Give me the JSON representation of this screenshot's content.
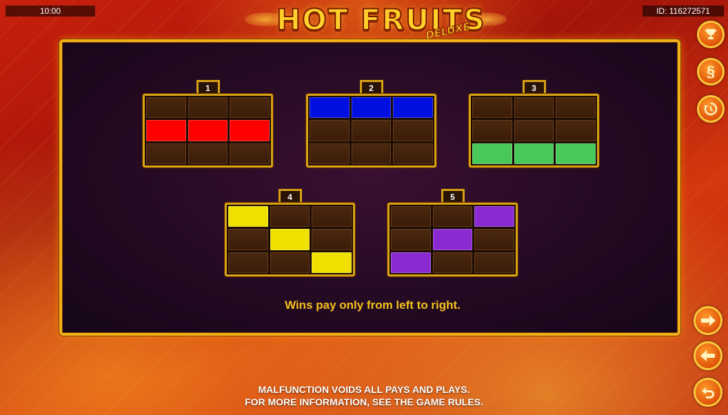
{
  "status": {
    "time": "10:00",
    "game_id": "ID: 116272571"
  },
  "logo": {
    "main": "HOT FRUITS",
    "sub": "DELUXE"
  },
  "paylines": [
    {
      "number": "1",
      "color": "#ff0000",
      "pattern": [
        [
          0,
          0,
          0
        ],
        [
          1,
          1,
          1
        ],
        [
          0,
          0,
          0
        ]
      ]
    },
    {
      "number": "2",
      "color": "#0010e0",
      "pattern": [
        [
          1,
          1,
          1
        ],
        [
          0,
          0,
          0
        ],
        [
          0,
          0,
          0
        ]
      ]
    },
    {
      "number": "3",
      "color": "#48c858",
      "pattern": [
        [
          0,
          0,
          0
        ],
        [
          0,
          0,
          0
        ],
        [
          1,
          1,
          1
        ]
      ]
    },
    {
      "number": "4",
      "color": "#f0e000",
      "pattern": [
        [
          1,
          0,
          0
        ],
        [
          0,
          1,
          0
        ],
        [
          0,
          0,
          1
        ]
      ]
    },
    {
      "number": "5",
      "color": "#8a2ad0",
      "pattern": [
        [
          0,
          0,
          1
        ],
        [
          0,
          1,
          0
        ],
        [
          1,
          0,
          0
        ]
      ]
    }
  ],
  "note": "Wins pay only from left to right.",
  "disclaimer": {
    "line1": "MALFUNCTION VOIDS ALL PAYS AND PLAYS.",
    "line2": "FOR MORE INFORMATION, SEE THE GAME RULES."
  },
  "side_buttons": {
    "paytable_icon": "trophy-icon",
    "rules_icon": "section-icon",
    "history_icon": "history-icon",
    "rules_symbol": "§"
  },
  "nav_buttons": {
    "next_icon": "arrow-right-icon",
    "prev_icon": "arrow-left-icon",
    "back_icon": "return-icon"
  },
  "colors": {
    "frame": "#f2b21a",
    "text_gold": "#f6c21e"
  }
}
